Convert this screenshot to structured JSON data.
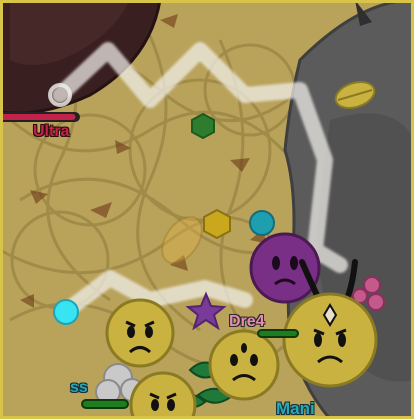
{
  "boss": {
    "rarity_label": "Ultra",
    "rarity_color": "#c3224a",
    "health_fraction": 0.95
  },
  "players": [
    {
      "name": "Dre4",
      "name_color": "#e58bb6"
    },
    {
      "name": "ss",
      "name_color": "#2aa7b5"
    },
    {
      "name": "Mani",
      "name_color": "#2aa7b5"
    }
  ],
  "colors": {
    "ground": "#b9a25a",
    "flower_yellow": "#c9b23f",
    "rock_grey": "#5b5b5b",
    "ladybug_dark": "#3a1f20",
    "lightning_white": "#f3f1ec",
    "player_purple": "#7a2f86",
    "cyan_petal": "#38d6e8"
  },
  "icons": {
    "boss_creature": "ultra-ladybug-boss-icon",
    "rock_mob": "rock-boss-icon",
    "lightning": "lightning-petal-icon",
    "leaf": "leaf-petal-icon",
    "star": "starfish-petal-icon",
    "pollen": "pollen-petal-icon",
    "cactus": "cactus-petal-icon",
    "faster": "faster-petal-icon"
  }
}
